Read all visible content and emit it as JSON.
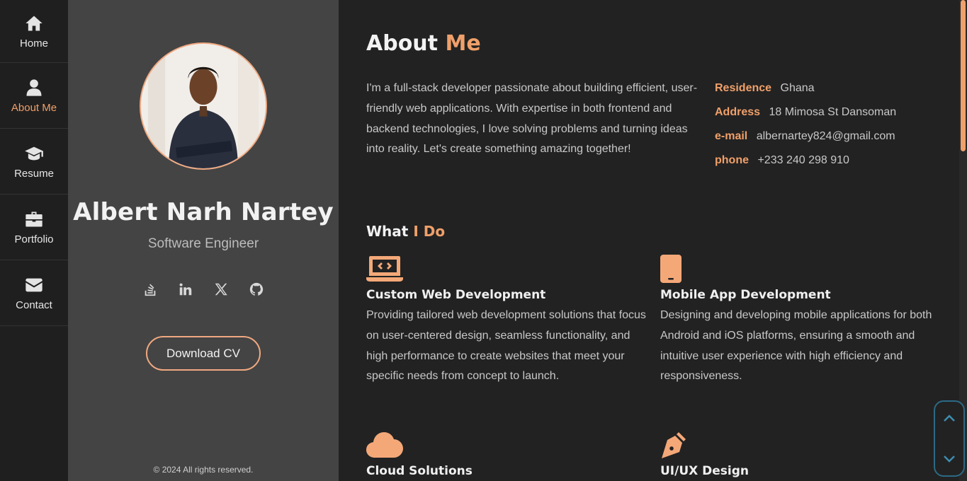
{
  "nav": {
    "items": [
      {
        "label": "Home",
        "icon": "home-icon"
      },
      {
        "label": "About Me",
        "icon": "user-icon",
        "active": true
      },
      {
        "label": "Resume",
        "icon": "graduation-cap-icon"
      },
      {
        "label": "Portfolio",
        "icon": "briefcase-icon"
      },
      {
        "label": "Contact",
        "icon": "envelope-icon"
      }
    ]
  },
  "profile": {
    "name": "Albert Narh Nartey",
    "role": "Software Engineer",
    "socials": [
      "stack-overflow-icon",
      "linkedin-icon",
      "x-twitter-icon",
      "github-icon"
    ],
    "download_cv": "Download CV",
    "copyright": "© 2024 All rights reserved."
  },
  "about": {
    "title_plain": "About",
    "title_accent": "Me",
    "text": "I'm a full-stack developer passionate about building efficient, user-friendly web applications. With expertise in both frontend and backend technologies, I love solving problems and turning ideas into reality. Let's create something amazing together!",
    "info": [
      {
        "key": "Residence",
        "value": "Ghana"
      },
      {
        "key": "Address",
        "value": "18 Mimosa St Dansoman"
      },
      {
        "key": "e-mail",
        "value": "albernartey824@gmail.com"
      },
      {
        "key": "phone",
        "value": "+233 240 298 910"
      }
    ]
  },
  "what_i_do": {
    "title_plain": "What",
    "title_accent": "I Do",
    "services": [
      {
        "title": "Custom Web Development",
        "icon": "laptop-code-icon",
        "desc": "Providing tailored web development solutions that focus on user-centered design, seamless functionality, and high performance to create websites that meet your specific needs from concept to launch."
      },
      {
        "title": "Mobile App Development",
        "icon": "mobile-icon",
        "desc": "Designing and developing mobile applications for both Android and iOS platforms, ensuring a smooth and intuitive user experience with high efficiency and responsiveness."
      },
      {
        "title": "Cloud Solutions",
        "icon": "cloud-icon",
        "desc": ""
      },
      {
        "title": "UI/UX Design",
        "icon": "pen-nib-icon",
        "desc": ""
      }
    ]
  },
  "colors": {
    "accent": "#f0a06a",
    "nav_bg": "#1f1f1f",
    "profile_bg": "#444444",
    "main_bg": "#222222",
    "scroll_button": "#2b6a85"
  }
}
